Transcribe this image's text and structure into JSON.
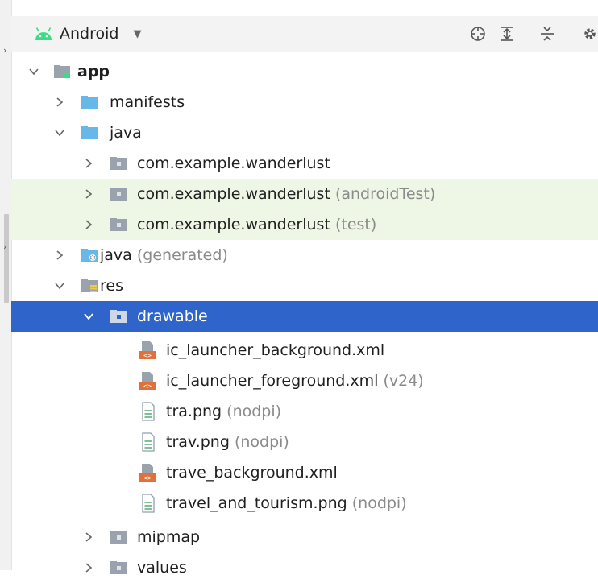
{
  "toolbar": {
    "view": "Android",
    "icons": [
      "target-icon",
      "expand-all-icon",
      "collapse-all-icon",
      "gear-icon"
    ]
  },
  "tree": [
    {
      "label": "app",
      "suffix": "",
      "icon": "module-icon",
      "expanded": true,
      "bold": true
    },
    {
      "label": "manifests",
      "suffix": "",
      "icon": "folder-icon",
      "expanded": false
    },
    {
      "label": "java",
      "suffix": "",
      "icon": "folder-icon",
      "expanded": true
    },
    {
      "label": "com.example.wanderlust",
      "suffix": "",
      "icon": "package-icon",
      "expanded": false
    },
    {
      "label": "com.example.wanderlust",
      "suffix": "(androidTest)",
      "icon": "package-icon",
      "expanded": false
    },
    {
      "label": "com.example.wanderlust",
      "suffix": "(test)",
      "icon": "package-icon",
      "expanded": false
    },
    {
      "label": "java",
      "suffix": "(generated)",
      "icon": "generated-folder-icon",
      "expanded": false
    },
    {
      "label": "res",
      "suffix": "",
      "icon": "res-folder-icon",
      "expanded": true
    },
    {
      "label": "drawable",
      "suffix": "",
      "icon": "folder-icon",
      "expanded": true,
      "selected": true
    },
    {
      "label": "ic_launcher_background.xml",
      "suffix": "",
      "icon": "xml-file-icon"
    },
    {
      "label": "ic_launcher_foreground.xml",
      "suffix": "(v24)",
      "icon": "xml-file-icon"
    },
    {
      "label": "tra.png",
      "suffix": "(nodpi)",
      "icon": "image-file-icon"
    },
    {
      "label": "trav.png",
      "suffix": "(nodpi)",
      "icon": "image-file-icon"
    },
    {
      "label": "trave_background.xml",
      "suffix": "",
      "icon": "xml-file-icon"
    },
    {
      "label": "travel_and_tourism.png",
      "suffix": "(nodpi)",
      "icon": "image-file-icon"
    },
    {
      "label": "mipmap",
      "suffix": "",
      "icon": "folder-icon",
      "expanded": false
    },
    {
      "label": "values",
      "suffix": "",
      "icon": "folder-icon",
      "expanded": false
    }
  ],
  "colors": {
    "selection": "#2f65ca",
    "test_highlight": "#eef6e6",
    "folder": "#67b7e8",
    "android_green": "#3ddc84",
    "suffix_gray": "#8a8a8a"
  }
}
